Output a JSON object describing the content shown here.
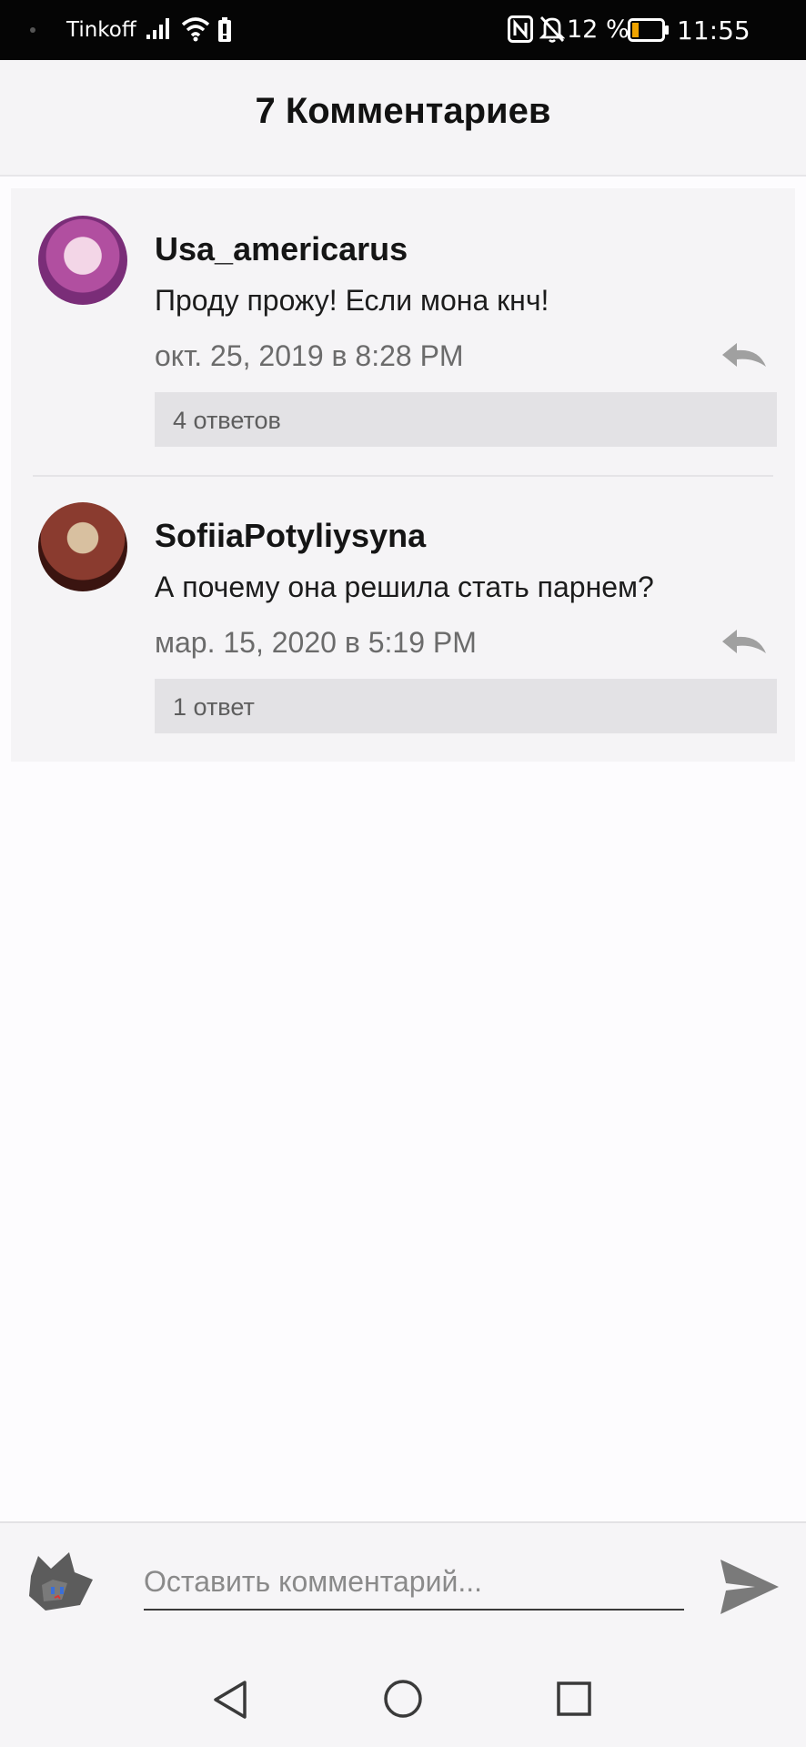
{
  "status_bar": {
    "carrier": "Tinkoff",
    "battery_percent": "12 %",
    "time": "11:55",
    "icons": [
      "signal-icon",
      "wifi-icon",
      "battery-saver-icon",
      "nfc-icon",
      "mute-bell-icon",
      "battery-icon"
    ]
  },
  "header": {
    "title": "7 Комментариев"
  },
  "comments": [
    {
      "username": "Usa_americarus",
      "text": "Проду прожу! Если мона кнч!",
      "date": "окт. 25, 2019 в 8:28 PM",
      "replies": "4 ответов"
    },
    {
      "username": "SofiiaPotyliysyna",
      "text": "А почему она решила стать парнем?",
      "date": "мар. 15, 2020 в 5:19 PM",
      "replies": "1 ответ"
    }
  ],
  "composer": {
    "placeholder": "Оставить комментарий..."
  },
  "colors": {
    "background": "#fdfcfe",
    "card": "#f5f4f6",
    "replies_bg": "#e3e2e5",
    "icon_gray": "#a0a0a0",
    "send_gray": "#7a7a7a"
  }
}
